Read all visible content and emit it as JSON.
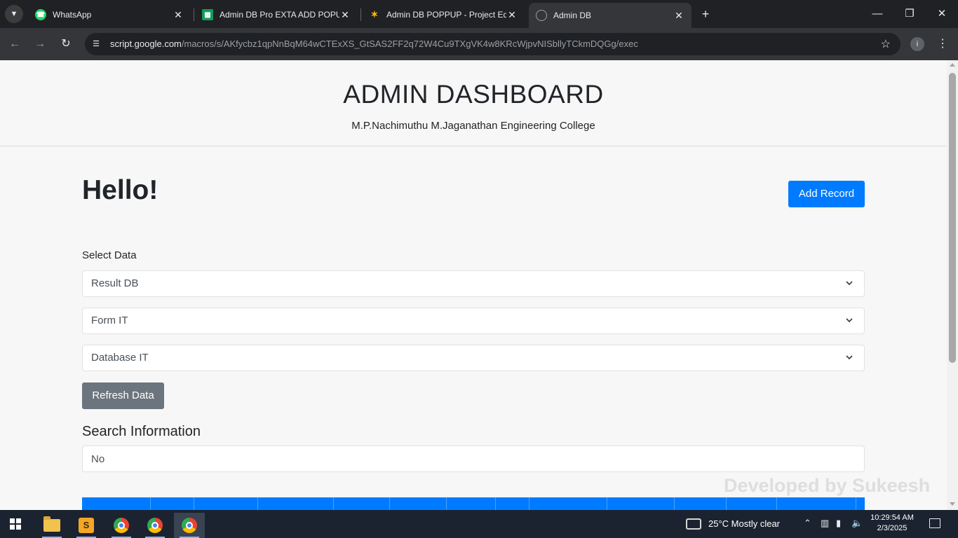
{
  "browser": {
    "tabs": [
      {
        "label": "WhatsApp",
        "favicon": "whatsapp-icon",
        "color": "#25d366",
        "active": false
      },
      {
        "label": "Admin DB Pro EXTA ADD POPUP",
        "favicon": "sheets-icon",
        "color": "#0f9d58",
        "active": false
      },
      {
        "label": "Admin DB POPPUP - Project Edi",
        "favicon": "apps-script-icon",
        "color": "#4285f4",
        "active": false
      },
      {
        "label": "Admin DB",
        "favicon": "globe-icon",
        "color": "#9aa0a6",
        "active": true
      }
    ],
    "url_domain": "script.google.com",
    "url_path": "/macros/s/AKfycbz1qpNnBqM64wCTExXS_GtSAS2FF2q72W4Cu9TXgVK4w8KRcWjpvNISbllyTCkmDQGg/exec"
  },
  "page": {
    "title": "ADMIN DASHBOARD",
    "subtitle": "M.P.Nachimuthu M.Jaganathan Engineering College",
    "greeting": "Hello!",
    "add_record_label": "Add Record",
    "select_label": "Select Data",
    "dropdowns": [
      {
        "value": "Result DB"
      },
      {
        "value": "Form IT"
      },
      {
        "value": "Database IT"
      }
    ],
    "refresh_label": "Refresh Data",
    "search_heading": "Search Information",
    "search_value": "No",
    "watermark": "Developed by Sukeesh",
    "accent_color": "#007bff"
  },
  "taskbar": {
    "weather": "25°C  Mostly clear",
    "time": "10:29:54 AM",
    "date": "2/3/2025"
  }
}
